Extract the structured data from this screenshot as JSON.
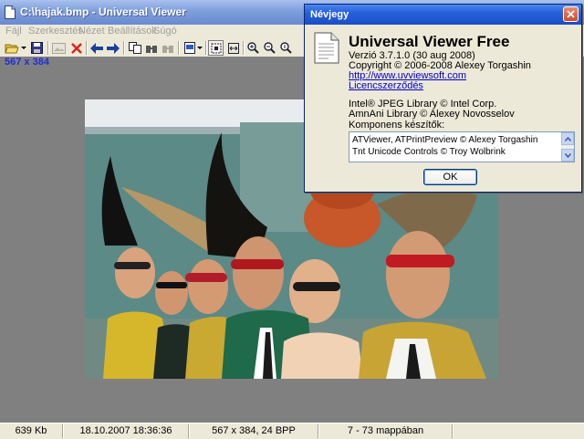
{
  "window": {
    "title": "C:\\hajak.bmp - Universal Viewer"
  },
  "menu": [
    "Fájl",
    "Szerkesztés",
    "Nézet",
    "Beállítások",
    "Súgó"
  ],
  "viewer": {
    "image_dims": "567 x 384"
  },
  "status": {
    "size": "639 Kb",
    "datetime": "18.10.2007 18:36:36",
    "info": "567 x 384, 24 BPP",
    "position": "7 - 73 mappában"
  },
  "about": {
    "title": "Névjegy",
    "product": "Universal Viewer Free",
    "version": "Verzió 3.7.1.0 (30 aug 2008)",
    "copyright": "Copyright © 2006-2008 Alexey Torgashin",
    "website": "http://www.uvviewsoft.com",
    "license": "Licencszerződés",
    "lib1": "Intel® JPEG Library © Intel Corp.",
    "lib2": "AmnAni Library © Alexey Novosselov",
    "components_label": "Komponens készítők:",
    "components": [
      "ATViewer, ATPrintPreview © Alexey Torgashin",
      "Tnt Unicode Controls © Troy Wolbrink"
    ],
    "ok_label": "OK"
  },
  "colors": {
    "title_blue": "#2861dd",
    "dims_text": "#1f2fd6",
    "link": "#0000d0"
  }
}
